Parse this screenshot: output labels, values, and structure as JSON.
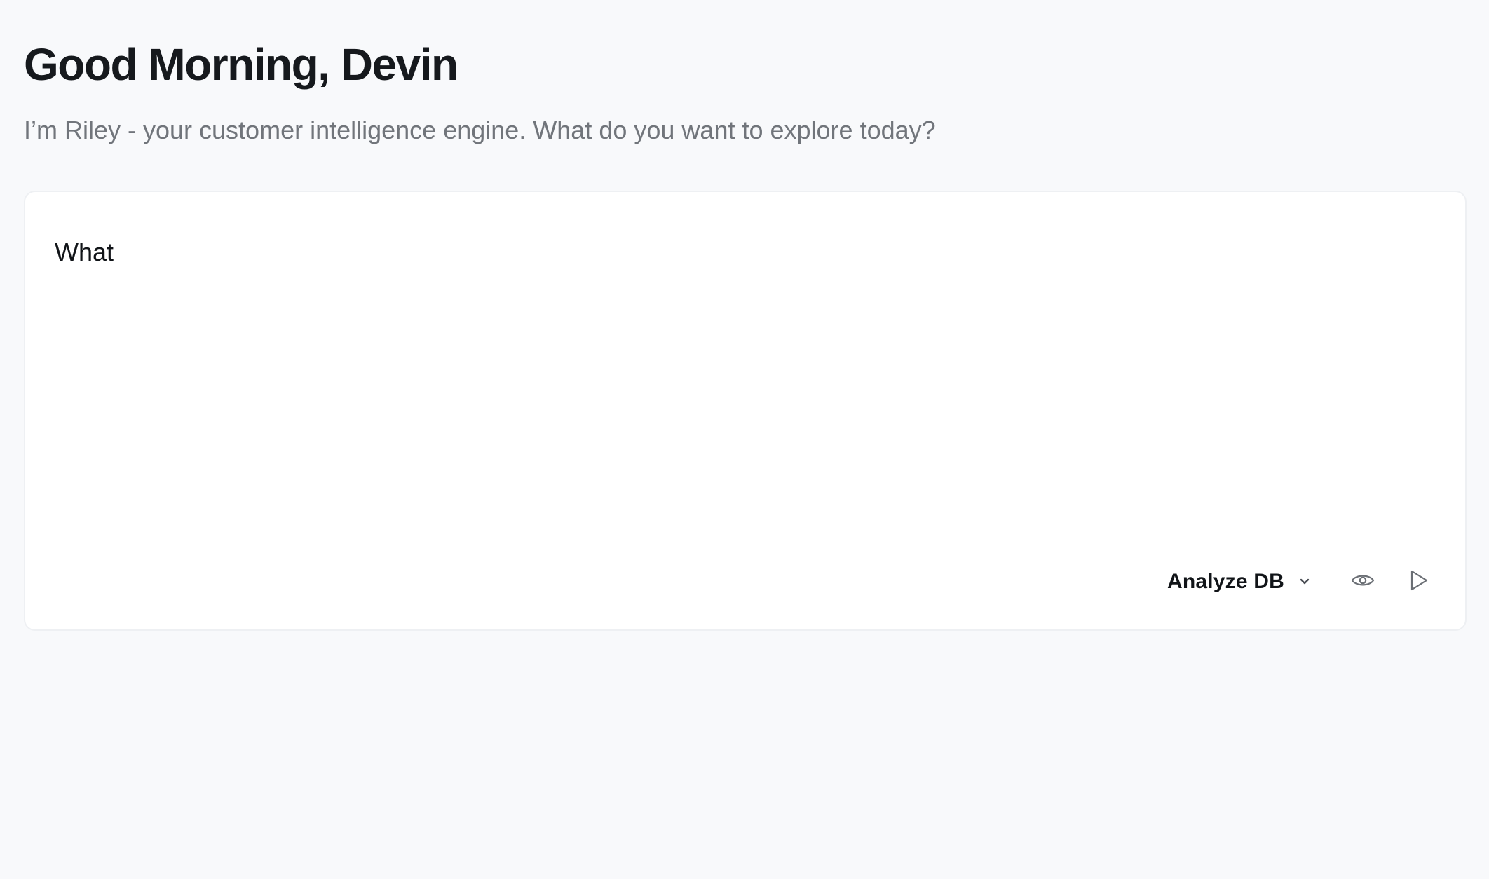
{
  "header": {
    "greeting": "Good Morning, Devin",
    "subtitle": "I’m Riley - your customer intelligence engine. What do you want to explore today?"
  },
  "composer": {
    "input_value": "What",
    "mode_select": {
      "selected": "Analyze DB",
      "icon": "chevron-down-icon"
    },
    "actions": [
      {
        "name": "preview",
        "icon": "eye-icon"
      },
      {
        "name": "send",
        "icon": "send-icon"
      }
    ]
  },
  "colors": {
    "background": "#f8f9fb",
    "card": "#ffffff",
    "card_border": "#eef0f3",
    "heading": "#16191d",
    "muted_text": "#71757b",
    "icon": "#6b6f75"
  }
}
